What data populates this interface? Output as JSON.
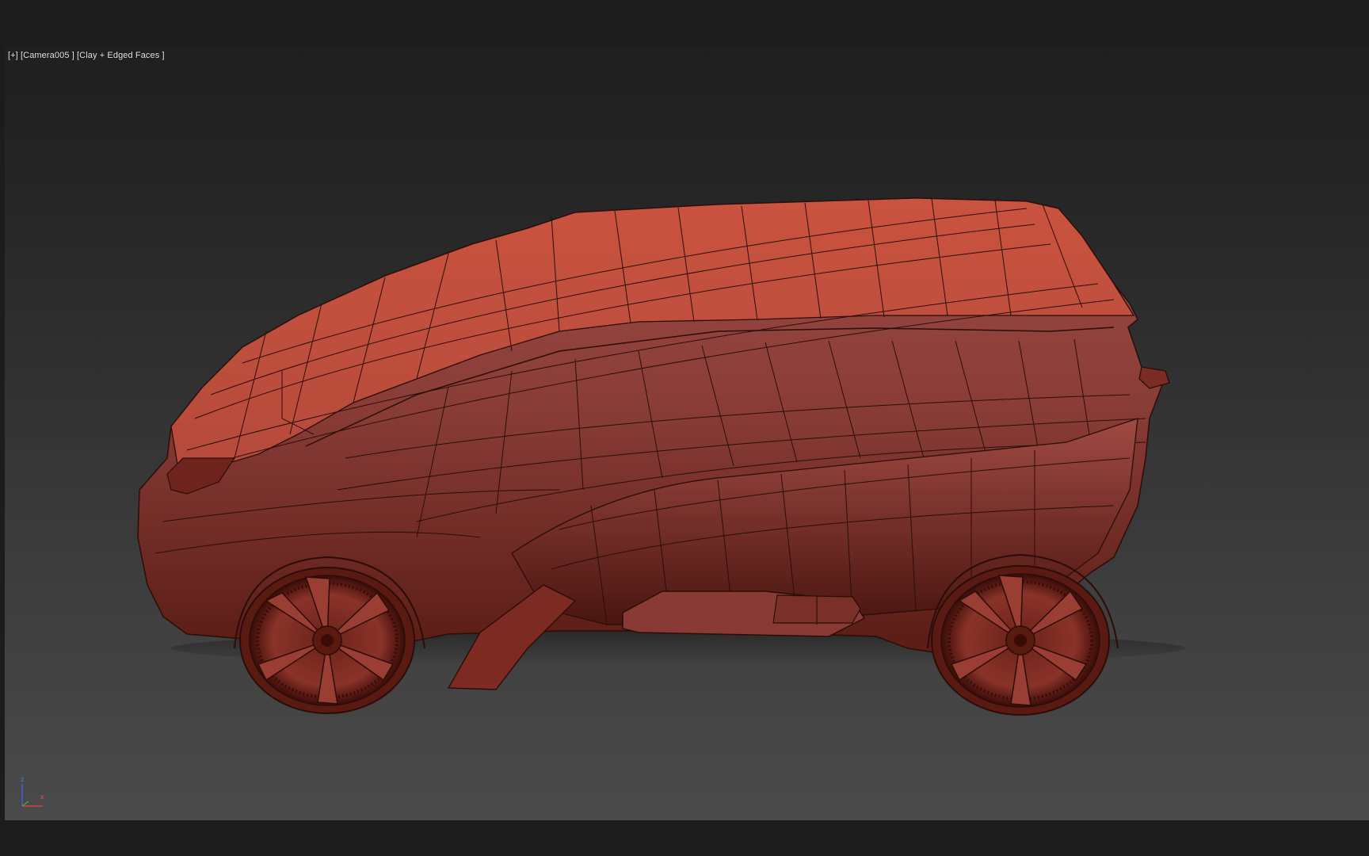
{
  "viewport": {
    "label": {
      "plus": "[+]",
      "camera": "[Camera005 ]",
      "shading": "[Clay + Edged Faces ]"
    },
    "axis": {
      "z": "z",
      "x": "x"
    }
  },
  "colors": {
    "background": "#1c1c1c",
    "clay": "#a8463a",
    "wire": "#2a0d08"
  }
}
